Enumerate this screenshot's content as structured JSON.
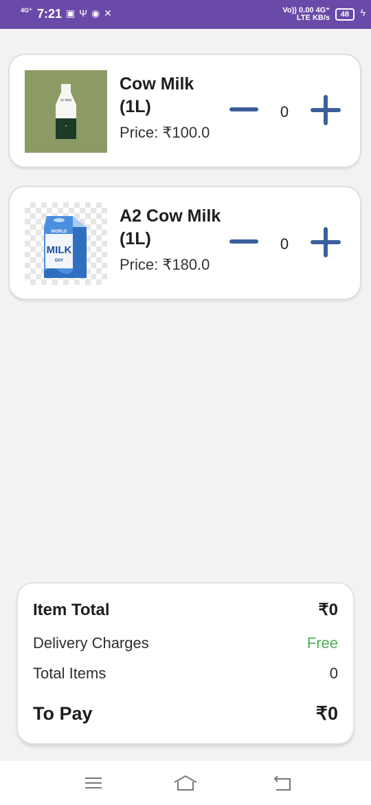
{
  "status_bar": {
    "network_type": "4G⁺",
    "time": "7:21",
    "volte_label": "Vo))",
    "lte_label": "LTE",
    "speed_value": "0.00",
    "speed_unit": "KB/s",
    "signal_type": "4G⁺",
    "battery": "48"
  },
  "products": [
    {
      "name": "Cow Milk (1L)",
      "price": "Price: ₹100.0",
      "quantity": "0",
      "image_icon": "milk-bottle-icon"
    },
    {
      "name": "A2 Cow Milk (1L)",
      "price": "Price: ₹180.0",
      "quantity": "0",
      "image_icon": "milk-carton-icon"
    }
  ],
  "product_image_texts": {
    "bottle_label": "A2 Milk",
    "carton_world": "WORLD",
    "carton_milk": "MILK",
    "carton_day": "DAY"
  },
  "summary": {
    "item_total_label": "Item Total",
    "item_total_value": "₹0",
    "delivery_label": "Delivery Charges",
    "delivery_value": "Free",
    "total_items_label": "Total Items",
    "total_items_value": "0",
    "to_pay_label": "To Pay",
    "to_pay_value": "₹0"
  },
  "colors": {
    "status_bar": "#6a4aa8",
    "stepper": "#3b5f9c",
    "free_text": "#4caf50"
  }
}
